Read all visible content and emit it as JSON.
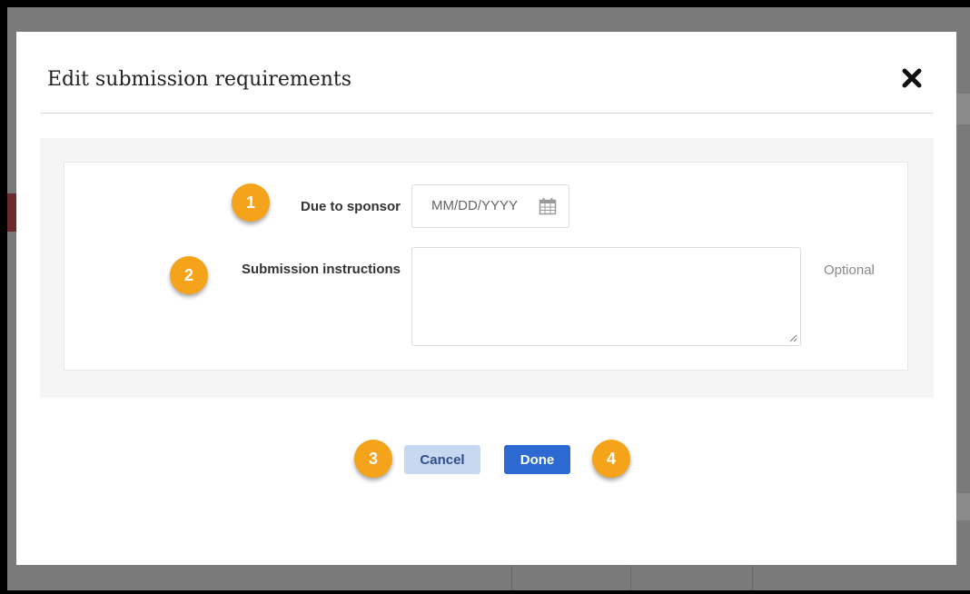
{
  "dialog": {
    "title": "Edit submission requirements",
    "close_icon": "close-icon"
  },
  "form": {
    "due_label": "Due to sponsor",
    "due_placeholder": "MM/DD/YYYY",
    "due_icon": "calendar-icon",
    "instructions_label": "Submission instructions",
    "instructions_value": "",
    "instructions_hint": "Optional"
  },
  "actions": {
    "cancel_label": "Cancel",
    "done_label": "Done"
  },
  "callouts": [
    "1",
    "2",
    "3",
    "4"
  ],
  "colors": {
    "accent": "#2c6ad1",
    "callout": "#f5a31a",
    "cancel_bg": "#c9d8f1"
  }
}
